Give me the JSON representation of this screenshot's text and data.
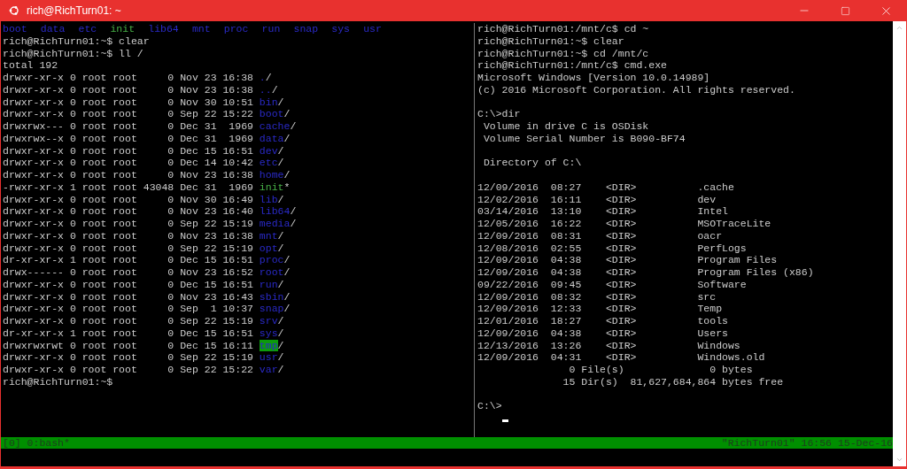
{
  "window": {
    "title": "rich@RichTurn01: ~"
  },
  "left_pane": {
    "listing": [
      {
        "name": "boot",
        "kind": "dir"
      },
      {
        "name": "data",
        "kind": "dir"
      },
      {
        "name": "etc",
        "kind": "dir"
      },
      {
        "name": "init",
        "kind": "exec"
      },
      {
        "name": "lib64",
        "kind": "dir"
      },
      {
        "name": "mnt",
        "kind": "dir"
      },
      {
        "name": "proc",
        "kind": "dir"
      },
      {
        "name": "run",
        "kind": "dir"
      },
      {
        "name": "snap",
        "kind": "dir"
      },
      {
        "name": "sys",
        "kind": "dir"
      },
      {
        "name": "usr",
        "kind": "dir"
      }
    ],
    "commands": [
      "rich@RichTurn01:~$ clear",
      "rich@RichTurn01:~$ ll /",
      "total 192"
    ],
    "rows": [
      {
        "info": "drwxr-xr-x 0 root root     0 Nov 23 16:38",
        "name": ".",
        "kind": "dir",
        "suffix": "/"
      },
      {
        "info": "drwxr-xr-x 0 root root     0 Nov 23 16:38",
        "name": "..",
        "kind": "dir",
        "suffix": "/"
      },
      {
        "info": "drwxr-xr-x 0 root root     0 Nov 30 10:51",
        "name": "bin",
        "kind": "dir",
        "suffix": "/"
      },
      {
        "info": "drwxr-xr-x 0 root root     0 Sep 22 15:22",
        "name": "boot",
        "kind": "dir",
        "suffix": "/"
      },
      {
        "info": "drwxrwx--- 0 root root     0 Dec 31  1969",
        "name": "cache",
        "kind": "dir",
        "suffix": "/"
      },
      {
        "info": "drwxrwx--x 0 root root     0 Dec 31  1969",
        "name": "data",
        "kind": "dir",
        "suffix": "/"
      },
      {
        "info": "drwxr-xr-x 0 root root     0 Dec 15 16:51",
        "name": "dev",
        "kind": "dir",
        "suffix": "/"
      },
      {
        "info": "drwxr-xr-x 0 root root     0 Dec 14 10:42",
        "name": "etc",
        "kind": "dir",
        "suffix": "/"
      },
      {
        "info": "drwxr-xr-x 0 root root     0 Nov 23 16:38",
        "name": "home",
        "kind": "dir",
        "suffix": "/"
      },
      {
        "info": "-rwxr-xr-x 1 root root 43048 Dec 31  1969",
        "name": "init",
        "kind": "exec",
        "suffix": "*"
      },
      {
        "info": "drwxr-xr-x 0 root root     0 Nov 30 16:49",
        "name": "lib",
        "kind": "dir",
        "suffix": "/"
      },
      {
        "info": "drwxr-xr-x 0 root root     0 Nov 23 16:40",
        "name": "lib64",
        "kind": "dir",
        "suffix": "/"
      },
      {
        "info": "drwxr-xr-x 0 root root     0 Sep 22 15:19",
        "name": "media",
        "kind": "dir",
        "suffix": "/"
      },
      {
        "info": "drwxr-xr-x 0 root root     0 Nov 23 16:38",
        "name": "mnt",
        "kind": "dir",
        "suffix": "/"
      },
      {
        "info": "drwxr-xr-x 0 root root     0 Sep 22 15:19",
        "name": "opt",
        "kind": "dir",
        "suffix": "/"
      },
      {
        "info": "dr-xr-xr-x 1 root root     0 Dec 15 16:51",
        "name": "proc",
        "kind": "dir",
        "suffix": "/"
      },
      {
        "info": "drwx------ 0 root root     0 Nov 23 16:52",
        "name": "root",
        "kind": "dir",
        "suffix": "/"
      },
      {
        "info": "drwxr-xr-x 0 root root     0 Dec 15 16:51",
        "name": "run",
        "kind": "dir",
        "suffix": "/"
      },
      {
        "info": "drwxr-xr-x 0 root root     0 Nov 23 16:43",
        "name": "sbin",
        "kind": "dir",
        "suffix": "/"
      },
      {
        "info": "drwxr-xr-x 0 root root     0 Sep  1 10:37",
        "name": "snap",
        "kind": "dir",
        "suffix": "/"
      },
      {
        "info": "drwxr-xr-x 0 root root     0 Sep 22 15:19",
        "name": "srv",
        "kind": "dir",
        "suffix": "/"
      },
      {
        "info": "dr-xr-xr-x 1 root root     0 Dec 15 16:51",
        "name": "sys",
        "kind": "dir",
        "suffix": "/"
      },
      {
        "info": "drwxrwxrwt 0 root root     0 Dec 15 16:11",
        "name": "tmp",
        "kind": "sticky",
        "suffix": "/"
      },
      {
        "info": "drwxr-xr-x 0 root root     0 Sep 22 15:19",
        "name": "usr",
        "kind": "dir",
        "suffix": "/"
      },
      {
        "info": "drwxr-xr-x 0 root root     0 Sep 22 15:22",
        "name": "var",
        "kind": "dir",
        "suffix": "/"
      }
    ],
    "prompt": "rich@RichTurn01:~$"
  },
  "right_pane": {
    "blocks": [
      [
        "rich@RichTurn01:/mnt/c$ cd ~",
        "rich@RichTurn01:~$ clear",
        "rich@RichTurn01:~$ cd /mnt/c",
        "rich@RichTurn01:/mnt/c$ cmd.exe",
        "Microsoft Windows [Version 10.0.14989]",
        "(c) 2016 Microsoft Corporation. All rights reserved."
      ],
      [
        "C:\\>dir",
        " Volume in drive C is OSDisk",
        " Volume Serial Number is B090-BF74"
      ],
      [
        " Directory of C:\\"
      ],
      [
        "12/09/2016  08:27    <DIR>          .cache",
        "12/02/2016  16:11    <DIR>          dev",
        "03/14/2016  13:10    <DIR>          Intel",
        "12/05/2016  16:22    <DIR>          MSOTraceLite",
        "12/09/2016  08:31    <DIR>          oacr",
        "12/08/2016  02:55    <DIR>          PerfLogs",
        "12/09/2016  04:38    <DIR>          Program Files",
        "12/09/2016  04:38    <DIR>          Program Files (x86)",
        "09/22/2016  09:45    <DIR>          Software",
        "12/09/2016  08:32    <DIR>          src",
        "12/09/2016  12:33    <DIR>          Temp",
        "12/01/2016  18:27    <DIR>          tools",
        "12/09/2016  04:38    <DIR>          Users",
        "12/13/2016  13:26    <DIR>          Windows",
        "12/09/2016  04:31    <DIR>          Windows.old",
        "               0 File(s)              0 bytes",
        "              15 Dir(s)  81,627,684,864 bytes free"
      ],
      [
        "C:\\>"
      ]
    ]
  },
  "status_bar": {
    "left": "[0] 0:bash*",
    "right": "\"RichTurn01\" 16:56 15-Dec-16"
  }
}
